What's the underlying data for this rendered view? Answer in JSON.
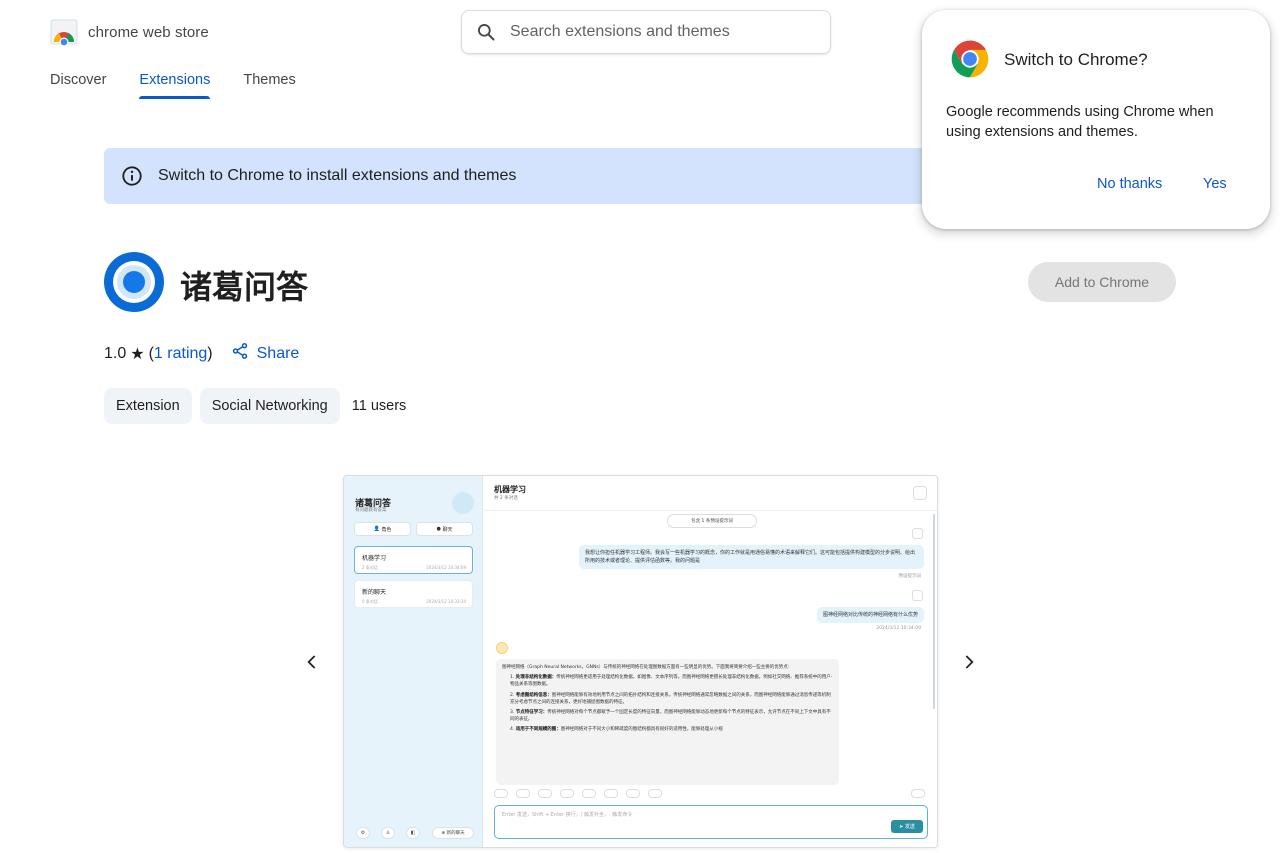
{
  "header": {
    "logo_text": "chrome web store",
    "search_placeholder": "Search extensions and themes"
  },
  "nav": {
    "items": [
      {
        "label": "Discover",
        "active": false
      },
      {
        "label": "Extensions",
        "active": true
      },
      {
        "label": "Themes",
        "active": false
      }
    ]
  },
  "banner": {
    "text": "Switch to Chrome to install extensions and themes"
  },
  "extension": {
    "title": "诸葛问答",
    "add_button": "Add to Chrome",
    "rating_value": "1.0",
    "rating_count_text": "1 rating",
    "share_label": "Share",
    "chips": [
      "Extension",
      "Social Networking"
    ],
    "users": "11 users"
  },
  "screenshot": {
    "sidebar": {
      "title": "诸葛问答",
      "subtitle": "有问题就有答案",
      "btn_role": "角色",
      "btn_chat": "聊天",
      "conversations": [
        {
          "title": "机器学习",
          "count": "2 条对话",
          "date": "2024/3/12 10:34:09",
          "active": true
        },
        {
          "title": "新的聊天",
          "count": "0 条对话",
          "date": "2024/3/12 10:33:34",
          "active": false
        }
      ],
      "new_chat": "新的聊天"
    },
    "main": {
      "title": "机器学习",
      "subtitle": "共 2 条对话",
      "context_pill": "包含 1 条预设提示词",
      "user_msg_1": "我想让你担任机器学习工程师。我会写一些机器学习的概念，你的工作就是用通俗易懂的术语来解释它们。这可能包括提供构建模型的分步说明、给出所用的技术或者理论、提供评估函数等。我的问题是",
      "user_msg_1_time": "预设提示词",
      "user_msg_2": "图神经网络对比传统的神经网络有什么优势",
      "user_msg_2_time": "2024/3/12 10:34:09",
      "bot_intro": "图神经网络（Graph Neural Networks，GNNs）与传统的神经网络在处理图数据方面有一些明显的优势。下面我将简要介绍一些主要的优势点：",
      "bot_points": [
        {
          "head": "处理非结构化数据：",
          "body": "传统神经网络更适用于处理结构化数据，如图像、文本序列等。而图神经网络更擅长处理非结构化数据，例如社交网络、推荐系统中的用户-物品关系等图数据。"
        },
        {
          "head": "考虑图结构信息：",
          "body": "图神经网络能够有效地利用节点之间的拓扑结构和连接关系。传统神经网络通常忽略数据之间的关系，而图神经网络能够通过消息传递等机制充分考虑节点之间的连接关系，更好地捕捉图数据的特征。"
        },
        {
          "head": "节点特征学习：",
          "body": "传统神经网络对每个节点都赋予一个固定长度的特征向量，而图神经网络能够动态地更新每个节点的特征表示，允许节点在不同上下文中具有不同的表征。"
        },
        {
          "head": "适用于不同规模的图：",
          "body": "图神经网络对于不同大小和稀疏度的图结构都具有很好的适用性，能够处理从小规"
        }
      ],
      "input_placeholder": "Enter 发送，Shift + Enter 换行，/ 触发补全，: 触发命令",
      "send_label": "发送"
    }
  },
  "popup": {
    "title": "Switch to Chrome?",
    "body": "Google recommends using Chrome when using extensions and themes.",
    "no_label": "No thanks",
    "yes_label": "Yes"
  },
  "colors": {
    "accent": "#0b57d0",
    "banner_bg": "#d3e3fd",
    "chip_bg": "#f0f4f9",
    "disabled_btn_bg": "#e3e3e3"
  }
}
